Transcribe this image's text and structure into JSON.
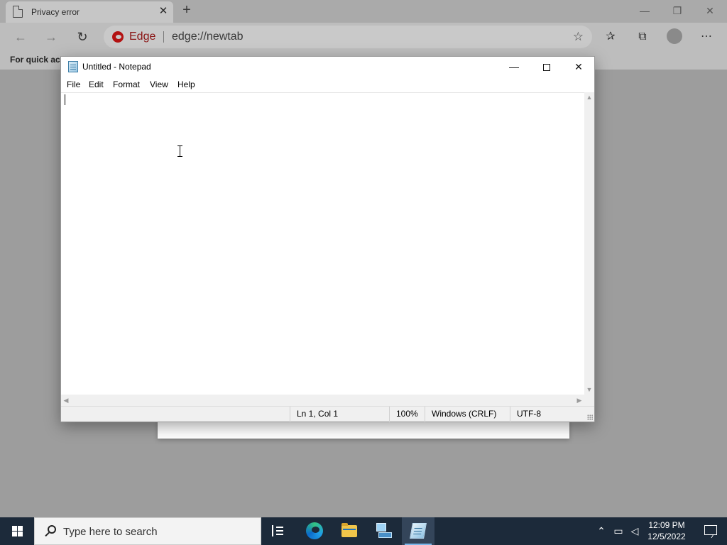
{
  "browser": {
    "tab_title": "Privacy error",
    "tab_close": "✕",
    "new_tab": "+",
    "brand": "Edge",
    "url": "edge://newtab",
    "favorites_bar_text": "For quick acc",
    "window_controls": {
      "minimize": "—",
      "restore": "❐",
      "close": "✕"
    }
  },
  "notepad": {
    "title": "Untitled - Notepad",
    "controls": {
      "minimize": "—",
      "close": "✕"
    },
    "menu": [
      "File",
      "Edit",
      "Format",
      "View",
      "Help"
    ],
    "content": "",
    "status": {
      "position": "Ln 1, Col 1",
      "zoom": "100%",
      "line_ending": "Windows (CRLF)",
      "encoding": "UTF-8"
    }
  },
  "taskbar": {
    "search_placeholder": "Type here to search",
    "apps": [
      "task-view",
      "microsoft-edge",
      "file-explorer",
      "server-manager",
      "notepad"
    ],
    "active_app": "notepad",
    "clock_time": "12:09 PM",
    "clock_date": "12/5/2022"
  },
  "colors": {
    "taskbar_bg": "#1c2a3a",
    "edge_brand": "#b31212",
    "overlay_gray": "#9d9d9d"
  }
}
